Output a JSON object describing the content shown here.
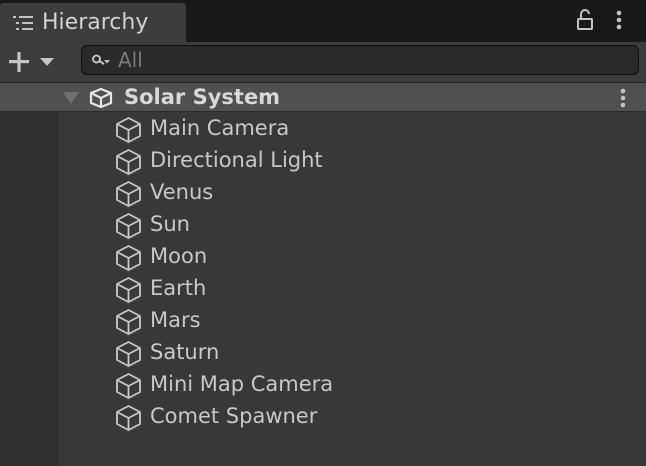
{
  "panel": {
    "title": "Hierarchy",
    "tab_icon": "list-icon",
    "lock_icon": "lock-icon",
    "menu_icon": "kebab-menu-icon"
  },
  "toolbar": {
    "add_icon": "plus-dropdown-icon",
    "search": {
      "placeholder": "All",
      "value": "",
      "icon": "search-icon"
    }
  },
  "scene": {
    "name": "Solar System",
    "icon": "unity-logo-icon",
    "expanded": true,
    "menu_icon": "kebab-menu-icon"
  },
  "objects": [
    {
      "name": "Main Camera",
      "icon": "cube-icon"
    },
    {
      "name": "Directional Light",
      "icon": "cube-icon"
    },
    {
      "name": "Venus",
      "icon": "cube-icon"
    },
    {
      "name": "Sun",
      "icon": "cube-icon"
    },
    {
      "name": "Moon",
      "icon": "cube-icon"
    },
    {
      "name": "Earth",
      "icon": "cube-icon"
    },
    {
      "name": "Mars",
      "icon": "cube-icon"
    },
    {
      "name": "Saturn",
      "icon": "cube-icon"
    },
    {
      "name": "Mini Map Camera",
      "icon": "cube-icon"
    },
    {
      "name": "Comet Spawner",
      "icon": "cube-icon"
    }
  ],
  "colors": {
    "background": "#383838",
    "tab_bar": "#191919",
    "selected_row": "#505050",
    "text": "#c8c8c8"
  }
}
